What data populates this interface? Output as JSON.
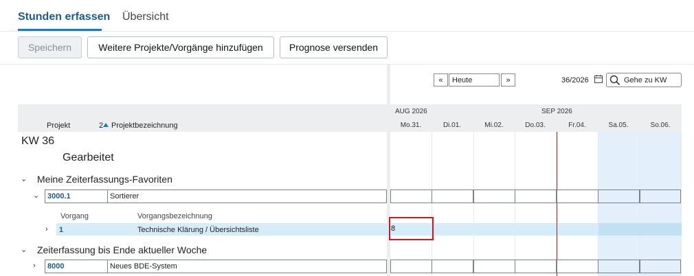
{
  "tabs": [
    {
      "label": "Stunden erfassen",
      "active": true
    },
    {
      "label": "Übersicht",
      "active": false
    }
  ],
  "toolbar": {
    "save_label": "Speichern",
    "add_label": "Weitere Projekte/Vorgänge hinzufügen",
    "forecast_label": "Prognose versenden"
  },
  "nav": {
    "prev_label": "«",
    "today_value": "Heute",
    "next_label": "»",
    "week_value": "36/2026",
    "goto_label": "Gehe zu KW"
  },
  "columns": {
    "project": "Projekt",
    "sort_num": "2",
    "project_desc": "Projektbezeichnung",
    "vorgang": "Vorgang",
    "vorgang_desc": "Vorgangsbezeichnung"
  },
  "calendar": {
    "months": [
      "AUG 2026",
      "SEP 2026"
    ],
    "days": [
      "Mo.31.",
      "Di.01.",
      "Mi.02.",
      "Do.03.",
      "Fr.04.",
      "Sa.05.",
      "So.06."
    ]
  },
  "content": {
    "kw_title": "KW 36",
    "section_title": "Gearbeitet",
    "groups": [
      {
        "title": "Meine Zeiterfassungs-Favoriten",
        "project": {
          "code": "3000.1",
          "name": "Sortierer"
        },
        "task": {
          "code": "1",
          "name": "Technische Klärung / Übersichtsliste",
          "entry": "8"
        }
      },
      {
        "title": "Zeiterfassung bis Ende aktueller Woche",
        "project": {
          "code": "8000",
          "name": "Neues BDE-System"
        }
      }
    ]
  },
  "colors": {
    "accent": "#1f5a8c",
    "selected_row": "#d5edf9",
    "weekend": "#e3effb",
    "today_line": "#a01818",
    "highlight": "#d9141b"
  }
}
